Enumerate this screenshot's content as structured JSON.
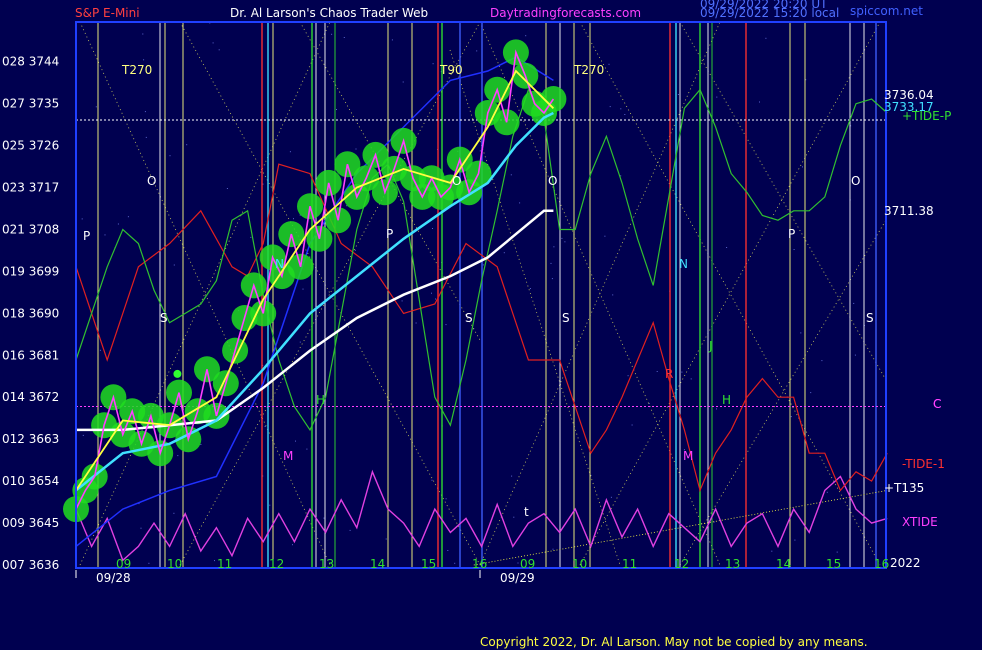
{
  "header": {
    "symbol": "S&P E-Mini",
    "author": "Dr. Al Larson's Chaos Trader Web",
    "site": "Daytradingforecasts.com",
    "timestamp_utc": "09/29/2022 20:20 UT",
    "timestamp_local": "09/29/2022 15:20 local",
    "watermark": "spiccom.net"
  },
  "copyright": "Copyright 2022, Dr. Al Larson. May not be copied by any means.",
  "colors": {
    "background": "#000050",
    "plot_frame": "#2040ff",
    "price": "#ff40ff",
    "glow": "#20dd20",
    "fast_avg": "#ffff40",
    "mid_avg": "#40e0ff",
    "slow_avg": "#ffffff",
    "tide_green": "#30c030",
    "tide_red": "#e02020",
    "xtide": "#e040e0"
  },
  "chart_data": {
    "type": "line",
    "title": "S&P E-Mini",
    "y_left_ticks": [
      {
        "label": "028 3744",
        "value": 3744
      },
      {
        "label": "027 3735",
        "value": 3735
      },
      {
        "label": "025 3726",
        "value": 3726
      },
      {
        "label": "023 3717",
        "value": 3717
      },
      {
        "label": "021 3708",
        "value": 3708
      },
      {
        "label": "019 3699",
        "value": 3699
      },
      {
        "label": "018 3690",
        "value": 3690
      },
      {
        "label": "016 3681",
        "value": 3681
      },
      {
        "label": "014 3672",
        "value": 3672
      },
      {
        "label": "012 3663",
        "value": 3663
      },
      {
        "label": "010 3654",
        "value": 3654
      },
      {
        "label": "009 3645",
        "value": 3645
      },
      {
        "label": "007 3636",
        "value": 3636
      }
    ],
    "ylim": [
      3636,
      3750
    ],
    "x_hours_day1": [
      "09",
      "10",
      "11",
      "12",
      "13",
      "14",
      "15",
      "16"
    ],
    "x_hours_day2": [
      "09",
      "10",
      "11",
      "12",
      "13",
      "14",
      "15",
      "16"
    ],
    "x_dates": [
      "09/28",
      "09/29"
    ],
    "year_label": "2022",
    "price_readouts": [
      "3736.04",
      "3733.17",
      "3711.38"
    ],
    "right_labels": [
      "+TIDE-P",
      "C",
      "-TIDE-1",
      "+T135",
      "XTIDE"
    ],
    "annotations": [
      "T270",
      "T270",
      "T90",
      "O",
      "O",
      "O",
      "O",
      "P",
      "P",
      "P",
      "S",
      "S",
      "S",
      "S",
      "N",
      "N",
      "M",
      "M",
      "H",
      "H",
      "R",
      "J",
      "t",
      "C"
    ],
    "reference_levels": [
      {
        "name": "white-dotted",
        "value": 3731.5
      },
      {
        "name": "magenta-dotted",
        "value": 3670
      }
    ],
    "price_series": [
      [
        0,
        3648
      ],
      [
        6,
        3652
      ],
      [
        12,
        3655
      ],
      [
        18,
        3666
      ],
      [
        24,
        3672
      ],
      [
        30,
        3664
      ],
      [
        36,
        3669
      ],
      [
        42,
        3662
      ],
      [
        48,
        3668
      ],
      [
        54,
        3660
      ],
      [
        60,
        3666
      ],
      [
        66,
        3673
      ],
      [
        72,
        3663
      ],
      [
        78,
        3669
      ],
      [
        84,
        3678
      ],
      [
        90,
        3668
      ],
      [
        96,
        3675
      ],
      [
        102,
        3682
      ],
      [
        108,
        3689
      ],
      [
        114,
        3696
      ],
      [
        120,
        3690
      ],
      [
        126,
        3702
      ],
      [
        132,
        3698
      ],
      [
        138,
        3707
      ],
      [
        144,
        3700
      ],
      [
        150,
        3713
      ],
      [
        156,
        3706
      ],
      [
        162,
        3718
      ],
      [
        168,
        3710
      ],
      [
        174,
        3722
      ],
      [
        180,
        3715
      ],
      [
        186,
        3719
      ],
      [
        192,
        3724
      ],
      [
        198,
        3716
      ],
      [
        204,
        3721
      ],
      [
        210,
        3727
      ],
      [
        216,
        3719
      ],
      [
        222,
        3715
      ],
      [
        228,
        3719
      ],
      [
        234,
        3715
      ],
      [
        240,
        3717
      ],
      [
        246,
        3723
      ],
      [
        252,
        3716
      ],
      [
        258,
        3720
      ],
      [
        264,
        3733
      ],
      [
        270,
        3738
      ],
      [
        276,
        3731
      ],
      [
        282,
        3746
      ],
      [
        288,
        3741
      ],
      [
        294,
        3735
      ],
      [
        300,
        3733
      ],
      [
        306,
        3736
      ]
    ],
    "fast_avg": [
      [
        0,
        3652
      ],
      [
        30,
        3667
      ],
      [
        60,
        3666
      ],
      [
        90,
        3672
      ],
      [
        120,
        3693
      ],
      [
        150,
        3708
      ],
      [
        180,
        3717
      ],
      [
        210,
        3721
      ],
      [
        240,
        3718
      ],
      [
        264,
        3730
      ],
      [
        282,
        3742
      ],
      [
        306,
        3734
      ]
    ],
    "mid_avg": [
      [
        0,
        3652
      ],
      [
        30,
        3660
      ],
      [
        60,
        3662
      ],
      [
        90,
        3667
      ],
      [
        120,
        3678
      ],
      [
        150,
        3690
      ],
      [
        180,
        3698
      ],
      [
        210,
        3706
      ],
      [
        240,
        3713
      ],
      [
        264,
        3718
      ],
      [
        282,
        3726
      ],
      [
        300,
        3732
      ],
      [
        306,
        3733
      ]
    ],
    "slow_avg": [
      [
        0,
        3665
      ],
      [
        30,
        3665
      ],
      [
        60,
        3666
      ],
      [
        90,
        3667
      ],
      [
        120,
        3674
      ],
      [
        150,
        3682
      ],
      [
        180,
        3689
      ],
      [
        210,
        3694
      ],
      [
        240,
        3698
      ],
      [
        264,
        3702
      ],
      [
        282,
        3707
      ],
      [
        300,
        3712
      ],
      [
        306,
        3712
      ]
    ],
    "green_tide": [
      [
        0,
        3680
      ],
      [
        20,
        3700
      ],
      [
        30,
        3708
      ],
      [
        40,
        3705
      ],
      [
        50,
        3695
      ],
      [
        60,
        3688
      ],
      [
        70,
        3690
      ],
      [
        80,
        3692
      ],
      [
        90,
        3697
      ],
      [
        100,
        3710
      ],
      [
        110,
        3712
      ],
      [
        120,
        3694
      ],
      [
        130,
        3680
      ],
      [
        140,
        3670
      ],
      [
        150,
        3665
      ],
      [
        160,
        3672
      ],
      [
        170,
        3690
      ],
      [
        180,
        3708
      ],
      [
        190,
        3719
      ],
      [
        200,
        3722
      ],
      [
        210,
        3714
      ],
      [
        220,
        3693
      ],
      [
        230,
        3672
      ],
      [
        240,
        3666
      ],
      [
        250,
        3680
      ],
      [
        260,
        3697
      ],
      [
        270,
        3712
      ],
      [
        280,
        3728
      ],
      [
        290,
        3738
      ],
      [
        300,
        3732
      ],
      [
        310,
        3708
      ],
      [
        320,
        3708
      ],
      [
        330,
        3720
      ],
      [
        340,
        3728
      ],
      [
        350,
        3718
      ],
      [
        360,
        3706
      ],
      [
        370,
        3696
      ],
      [
        380,
        3715
      ],
      [
        390,
        3734
      ],
      [
        400,
        3738
      ],
      [
        410,
        3730
      ],
      [
        420,
        3720
      ],
      [
        430,
        3716
      ],
      [
        440,
        3711
      ],
      [
        450,
        3710
      ],
      [
        460,
        3712
      ],
      [
        470,
        3712
      ],
      [
        480,
        3715
      ],
      [
        490,
        3726
      ],
      [
        500,
        3735
      ],
      [
        510,
        3736
      ],
      [
        520,
        3733
      ]
    ],
    "red_tide": [
      [
        0,
        3700
      ],
      [
        20,
        3680
      ],
      [
        40,
        3700
      ],
      [
        60,
        3705
      ],
      [
        80,
        3712
      ],
      [
        100,
        3700
      ],
      [
        110,
        3698
      ],
      [
        120,
        3705
      ],
      [
        130,
        3722
      ],
      [
        150,
        3720
      ],
      [
        170,
        3705
      ],
      [
        190,
        3700
      ],
      [
        210,
        3690
      ],
      [
        230,
        3692
      ],
      [
        250,
        3705
      ],
      [
        270,
        3700
      ],
      [
        280,
        3690
      ],
      [
        290,
        3680
      ],
      [
        300,
        3680
      ],
      [
        310,
        3680
      ],
      [
        320,
        3670
      ],
      [
        330,
        3660
      ],
      [
        340,
        3665
      ],
      [
        350,
        3672
      ],
      [
        360,
        3680
      ],
      [
        370,
        3688
      ],
      [
        380,
        3676
      ],
      [
        390,
        3665
      ],
      [
        400,
        3652
      ],
      [
        410,
        3660
      ],
      [
        420,
        3665
      ],
      [
        430,
        3672
      ],
      [
        440,
        3676
      ],
      [
        450,
        3672
      ],
      [
        460,
        3672
      ],
      [
        470,
        3660
      ],
      [
        480,
        3660
      ],
      [
        490,
        3652
      ],
      [
        500,
        3656
      ],
      [
        510,
        3654
      ],
      [
        520,
        3660
      ]
    ],
    "xtide": [
      [
        0,
        3648
      ],
      [
        10,
        3640
      ],
      [
        20,
        3646
      ],
      [
        30,
        3637
      ],
      [
        40,
        3640
      ],
      [
        50,
        3645
      ],
      [
        60,
        3640
      ],
      [
        70,
        3647
      ],
      [
        80,
        3639
      ],
      [
        90,
        3644
      ],
      [
        100,
        3638
      ],
      [
        110,
        3646
      ],
      [
        120,
        3641
      ],
      [
        130,
        3647
      ],
      [
        140,
        3641
      ],
      [
        150,
        3648
      ],
      [
        160,
        3643
      ],
      [
        170,
        3650
      ],
      [
        180,
        3644
      ],
      [
        190,
        3656
      ],
      [
        200,
        3648
      ],
      [
        210,
        3645
      ],
      [
        220,
        3640
      ],
      [
        230,
        3648
      ],
      [
        240,
        3643
      ],
      [
        250,
        3646
      ],
      [
        260,
        3640
      ],
      [
        270,
        3649
      ],
      [
        280,
        3640
      ],
      [
        290,
        3645
      ],
      [
        300,
        3647
      ],
      [
        310,
        3643
      ],
      [
        320,
        3648
      ],
      [
        330,
        3640
      ],
      [
        340,
        3650
      ],
      [
        350,
        3642
      ],
      [
        360,
        3648
      ],
      [
        370,
        3640
      ],
      [
        380,
        3647
      ],
      [
        390,
        3644
      ],
      [
        400,
        3641
      ],
      [
        410,
        3648
      ],
      [
        420,
        3640
      ],
      [
        430,
        3645
      ],
      [
        440,
        3647
      ],
      [
        450,
        3640
      ],
      [
        460,
        3648
      ],
      [
        470,
        3643
      ],
      [
        480,
        3652
      ],
      [
        490,
        3655
      ],
      [
        500,
        3648
      ],
      [
        510,
        3645
      ],
      [
        520,
        3646
      ]
    ],
    "blue_avg": [
      [
        0,
        3640
      ],
      [
        30,
        3648
      ],
      [
        60,
        3652
      ],
      [
        90,
        3655
      ],
      [
        120,
        3675
      ],
      [
        150,
        3705
      ],
      [
        180,
        3720
      ],
      [
        210,
        3730
      ],
      [
        240,
        3740
      ],
      [
        264,
        3742
      ],
      [
        282,
        3745
      ],
      [
        306,
        3740
      ]
    ],
    "cursor_dot": [
      3710,
      3677
    ],
    "t135_line": [
      [
        255,
        3636
      ],
      [
        520,
        3652
      ]
    ]
  }
}
